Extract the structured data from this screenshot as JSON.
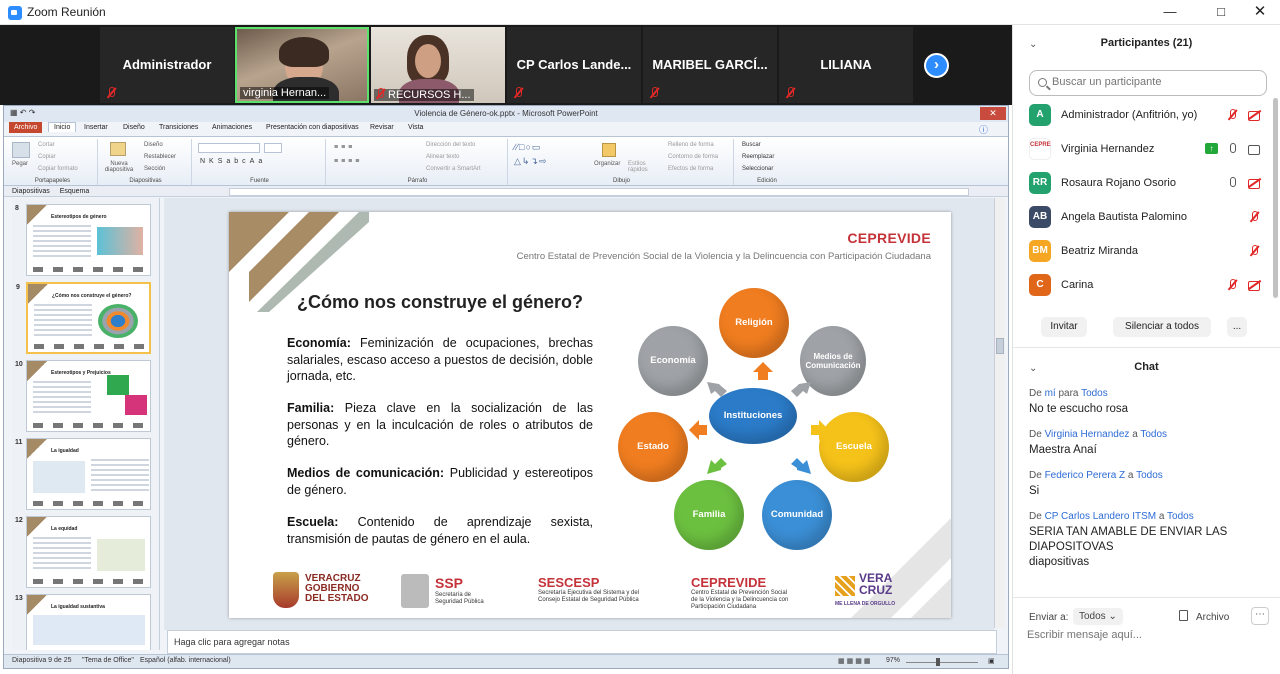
{
  "window": {
    "title": "Zoom Reunión"
  },
  "gallery": {
    "tiles": [
      {
        "name": "Administrador"
      },
      {
        "name": "virginia Hernan..."
      },
      {
        "name": "RECURSOS H..."
      },
      {
        "name": "CP Carlos Lande..."
      },
      {
        "name": "MARIBEL GARCÍ..."
      },
      {
        "name": "LILIANA"
      }
    ],
    "next_glyph": "›"
  },
  "ppt": {
    "title": "Violencia de Género-ok.pptx - Microsoft PowerPoint",
    "tabs": [
      "Archivo",
      "Inicio",
      "Insertar",
      "Diseño",
      "Transiciones",
      "Animaciones",
      "Presentación con diapositivas",
      "Revisar",
      "Vista"
    ],
    "ribbon": {
      "portapapeles": {
        "label": "Portapapeles",
        "items": [
          "Cortar",
          "Copiar",
          "Copiar formato",
          "Pegar"
        ]
      },
      "diapositivas": {
        "label": "Diapositivas",
        "items": [
          "Nueva diapositiva",
          "Diseño",
          "Restablecer",
          "Sección"
        ]
      },
      "fuente": {
        "label": "Fuente"
      },
      "parrafo": {
        "label": "Párrafo",
        "items": [
          "Dirección del texto",
          "Alinear texto",
          "Convertir a SmartArt"
        ]
      },
      "dibujo": {
        "label": "Dibujo",
        "items": [
          "Organizar",
          "Estilos rápidos",
          "Relleno de forma",
          "Contorno de forma",
          "Efectos de forma"
        ]
      },
      "edicion": {
        "label": "Edición",
        "items": [
          "Buscar",
          "Reemplazar",
          "Seleccionar"
        ]
      }
    },
    "pane_tabs": [
      "Diapositivas",
      "Esquema"
    ],
    "thumbs": [
      {
        "num": "8",
        "title": "Estereotipos de género"
      },
      {
        "num": "9",
        "title": "¿Cómo nos construye el género?"
      },
      {
        "num": "10",
        "title": "Estereotipos y Prejuicios"
      },
      {
        "num": "11",
        "title": "La igualdad"
      },
      {
        "num": "12",
        "title": "La equidad"
      },
      {
        "num": "13",
        "title": "La igualdad sustantiva"
      }
    ],
    "slide": {
      "brand": "CEPREVIDE",
      "subtitle": "Centro Estatal de Prevención Social de la Violencia y la Delincuencia con Participación Ciudadana",
      "title": "¿Cómo nos construye el género?",
      "paragraphs": [
        {
          "term": "Economía:",
          "text": " Feminización de ocupaciones, brechas salariales, escaso acceso a puestos de decisión, doble jornada, etc."
        },
        {
          "term": "Familia:",
          "text": " Pieza clave en la socialización de las personas y en la inculcación de roles o atributos de género."
        },
        {
          "term": "Medios de comunicación:",
          "text": " Publicidad y estereotipos de género."
        },
        {
          "term": "Escuela:",
          "text": " Contenido de aprendizaje sexista, transmisión de pautas de género en el aula."
        }
      ],
      "diagram": {
        "center": "Instituciones",
        "nodes": [
          "Religión",
          "Medios de Comunicación",
          "Escuela",
          "Comunidad",
          "Familia",
          "Estado",
          "Economía"
        ]
      },
      "logos": {
        "veracruz": {
          "line1": "VERACRUZ",
          "line2": "GOBIERNO",
          "line3": "DEL ESTADO"
        },
        "ssp": {
          "name": "SSP",
          "line1": "Secretaría de",
          "line2": "Seguridad Pública"
        },
        "sescesp": {
          "name": "SESCESP",
          "line1": "Secretaría Ejecutiva del Sistema y del",
          "line2": "Consejo Estatal de Seguridad Pública"
        },
        "ceprevide": {
          "name": "CEPREVIDE",
          "line1": "Centro Estatal de Prevención Social",
          "line2": "de la Violencia y la Delincuencia con",
          "line3": "Participación Ciudadana"
        },
        "veracruz2": {
          "line1": "VERA",
          "line2": "CRUZ",
          "tag": "ME LLENA DE ORGULLO"
        }
      }
    },
    "notes_placeholder": "Haga clic para agregar notas",
    "status": {
      "slide": "Diapositiva 9 de 25",
      "theme": "\"Tema de Office\"",
      "lang": "Español (alfab. internacional)",
      "zoom": "97%"
    }
  },
  "panel": {
    "participants_title": "Participantes (21)",
    "search_placeholder": "Buscar un participante",
    "participants": [
      {
        "initials": "A",
        "color": "#23a26d",
        "name": "Administrador (Anfitrión, yo)"
      },
      {
        "initials": "CEPRE",
        "color": "#ffffff",
        "name": "Virginia Hernandez"
      },
      {
        "initials": "RR",
        "color": "#23a26d",
        "name": "Rosaura Rojano Osorio"
      },
      {
        "initials": "AB",
        "color": "#3b4a66",
        "name": "Angela Bautista Palomino"
      },
      {
        "initials": "BM",
        "color": "#f5a623",
        "name": "Beatriz Miranda"
      },
      {
        "initials": "C",
        "color": "#e0661a",
        "name": "Carina"
      }
    ],
    "buttons": {
      "invite": "Invitar",
      "mute_all": "Silenciar a todos",
      "more": "..."
    },
    "chat_title": "Chat",
    "messages": [
      {
        "pre": "De ",
        "from": "mí",
        "mid": " para ",
        "to": "Todos",
        "text": "No te escucho rosa"
      },
      {
        "pre": "De ",
        "from": "Virginia Hernandez",
        "mid": " a ",
        "to": "Todos",
        "text": "Maestra Anaí"
      },
      {
        "pre": "De ",
        "from": "Federico Perera Z",
        "mid": " a ",
        "to": "Todos",
        "text": "Si"
      },
      {
        "pre": "De ",
        "from": "CP Carlos Landero ITSM",
        "mid": " a ",
        "to": "Todos",
        "text": "SERIA TAN AMABLE DE ENVIAR LAS DIAPOSITOVAS\ndiapositivas"
      }
    ],
    "send_to_label": "Enviar a:",
    "send_to_value": "Todos",
    "file_label": "Archivo",
    "chat_placeholder": "Escribir mensaje aquí..."
  }
}
